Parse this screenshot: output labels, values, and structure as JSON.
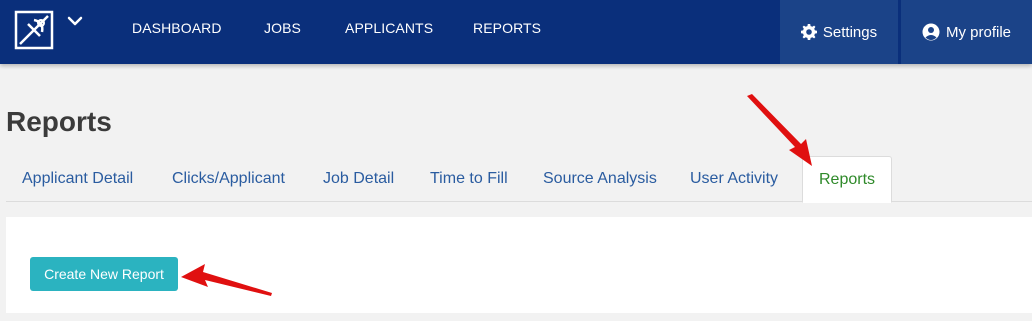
{
  "nav": {
    "items": [
      {
        "label": "DASHBOARD"
      },
      {
        "label": "JOBS"
      },
      {
        "label": "APPLICANTS"
      },
      {
        "label": "REPORTS"
      }
    ],
    "settings_label": "Settings",
    "profile_label": "My profile"
  },
  "page": {
    "title": "Reports"
  },
  "tabs": [
    {
      "label": "Applicant Detail"
    },
    {
      "label": "Clicks/Applicant"
    },
    {
      "label": "Job Detail"
    },
    {
      "label": "Time to Fill"
    },
    {
      "label": "Source Analysis"
    },
    {
      "label": "User Activity"
    },
    {
      "label": "Reports",
      "active": true
    }
  ],
  "panel": {
    "create_button_label": "Create New Report"
  },
  "icons": {
    "logo": "brand-logo-icon",
    "menu": "chevron-down-icon",
    "settings": "gear-icon",
    "profile": "user-circle-icon",
    "annotation": "red-arrow-icon"
  },
  "colors": {
    "topbar": "#0a2f7b",
    "topbar_button": "#1b4388",
    "link": "#2a5ca0",
    "active_tab": "#2f8a2a",
    "primary_button": "#2bb3c0",
    "annotation_arrow": "#e01010"
  }
}
